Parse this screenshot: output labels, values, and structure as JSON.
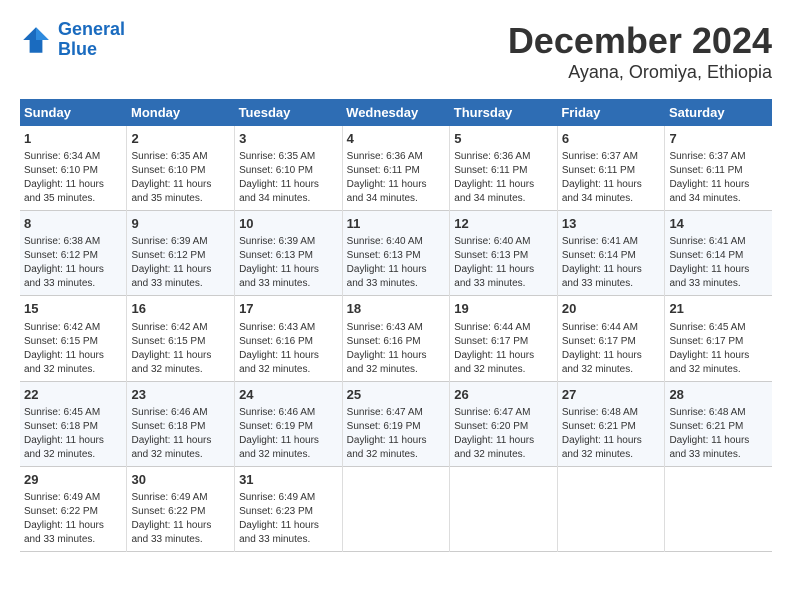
{
  "header": {
    "logo_line1": "General",
    "logo_line2": "Blue",
    "title": "December 2024",
    "subtitle": "Ayana, Oromiya, Ethiopia"
  },
  "days_of_week": [
    "Sunday",
    "Monday",
    "Tuesday",
    "Wednesday",
    "Thursday",
    "Friday",
    "Saturday"
  ],
  "weeks": [
    [
      {
        "day": "1",
        "info": "Sunrise: 6:34 AM\nSunset: 6:10 PM\nDaylight: 11 hours\nand 35 minutes."
      },
      {
        "day": "2",
        "info": "Sunrise: 6:35 AM\nSunset: 6:10 PM\nDaylight: 11 hours\nand 35 minutes."
      },
      {
        "day": "3",
        "info": "Sunrise: 6:35 AM\nSunset: 6:10 PM\nDaylight: 11 hours\nand 34 minutes."
      },
      {
        "day": "4",
        "info": "Sunrise: 6:36 AM\nSunset: 6:11 PM\nDaylight: 11 hours\nand 34 minutes."
      },
      {
        "day": "5",
        "info": "Sunrise: 6:36 AM\nSunset: 6:11 PM\nDaylight: 11 hours\nand 34 minutes."
      },
      {
        "day": "6",
        "info": "Sunrise: 6:37 AM\nSunset: 6:11 PM\nDaylight: 11 hours\nand 34 minutes."
      },
      {
        "day": "7",
        "info": "Sunrise: 6:37 AM\nSunset: 6:11 PM\nDaylight: 11 hours\nand 34 minutes."
      }
    ],
    [
      {
        "day": "8",
        "info": "Sunrise: 6:38 AM\nSunset: 6:12 PM\nDaylight: 11 hours\nand 33 minutes."
      },
      {
        "day": "9",
        "info": "Sunrise: 6:39 AM\nSunset: 6:12 PM\nDaylight: 11 hours\nand 33 minutes."
      },
      {
        "day": "10",
        "info": "Sunrise: 6:39 AM\nSunset: 6:13 PM\nDaylight: 11 hours\nand 33 minutes."
      },
      {
        "day": "11",
        "info": "Sunrise: 6:40 AM\nSunset: 6:13 PM\nDaylight: 11 hours\nand 33 minutes."
      },
      {
        "day": "12",
        "info": "Sunrise: 6:40 AM\nSunset: 6:13 PM\nDaylight: 11 hours\nand 33 minutes."
      },
      {
        "day": "13",
        "info": "Sunrise: 6:41 AM\nSunset: 6:14 PM\nDaylight: 11 hours\nand 33 minutes."
      },
      {
        "day": "14",
        "info": "Sunrise: 6:41 AM\nSunset: 6:14 PM\nDaylight: 11 hours\nand 33 minutes."
      }
    ],
    [
      {
        "day": "15",
        "info": "Sunrise: 6:42 AM\nSunset: 6:15 PM\nDaylight: 11 hours\nand 32 minutes."
      },
      {
        "day": "16",
        "info": "Sunrise: 6:42 AM\nSunset: 6:15 PM\nDaylight: 11 hours\nand 32 minutes."
      },
      {
        "day": "17",
        "info": "Sunrise: 6:43 AM\nSunset: 6:16 PM\nDaylight: 11 hours\nand 32 minutes."
      },
      {
        "day": "18",
        "info": "Sunrise: 6:43 AM\nSunset: 6:16 PM\nDaylight: 11 hours\nand 32 minutes."
      },
      {
        "day": "19",
        "info": "Sunrise: 6:44 AM\nSunset: 6:17 PM\nDaylight: 11 hours\nand 32 minutes."
      },
      {
        "day": "20",
        "info": "Sunrise: 6:44 AM\nSunset: 6:17 PM\nDaylight: 11 hours\nand 32 minutes."
      },
      {
        "day": "21",
        "info": "Sunrise: 6:45 AM\nSunset: 6:17 PM\nDaylight: 11 hours\nand 32 minutes."
      }
    ],
    [
      {
        "day": "22",
        "info": "Sunrise: 6:45 AM\nSunset: 6:18 PM\nDaylight: 11 hours\nand 32 minutes."
      },
      {
        "day": "23",
        "info": "Sunrise: 6:46 AM\nSunset: 6:18 PM\nDaylight: 11 hours\nand 32 minutes."
      },
      {
        "day": "24",
        "info": "Sunrise: 6:46 AM\nSunset: 6:19 PM\nDaylight: 11 hours\nand 32 minutes."
      },
      {
        "day": "25",
        "info": "Sunrise: 6:47 AM\nSunset: 6:19 PM\nDaylight: 11 hours\nand 32 minutes."
      },
      {
        "day": "26",
        "info": "Sunrise: 6:47 AM\nSunset: 6:20 PM\nDaylight: 11 hours\nand 32 minutes."
      },
      {
        "day": "27",
        "info": "Sunrise: 6:48 AM\nSunset: 6:21 PM\nDaylight: 11 hours\nand 32 minutes."
      },
      {
        "day": "28",
        "info": "Sunrise: 6:48 AM\nSunset: 6:21 PM\nDaylight: 11 hours\nand 33 minutes."
      }
    ],
    [
      {
        "day": "29",
        "info": "Sunrise: 6:49 AM\nSunset: 6:22 PM\nDaylight: 11 hours\nand 33 minutes."
      },
      {
        "day": "30",
        "info": "Sunrise: 6:49 AM\nSunset: 6:22 PM\nDaylight: 11 hours\nand 33 minutes."
      },
      {
        "day": "31",
        "info": "Sunrise: 6:49 AM\nSunset: 6:23 PM\nDaylight: 11 hours\nand 33 minutes."
      },
      {
        "day": "",
        "info": ""
      },
      {
        "day": "",
        "info": ""
      },
      {
        "day": "",
        "info": ""
      },
      {
        "day": "",
        "info": ""
      }
    ]
  ]
}
